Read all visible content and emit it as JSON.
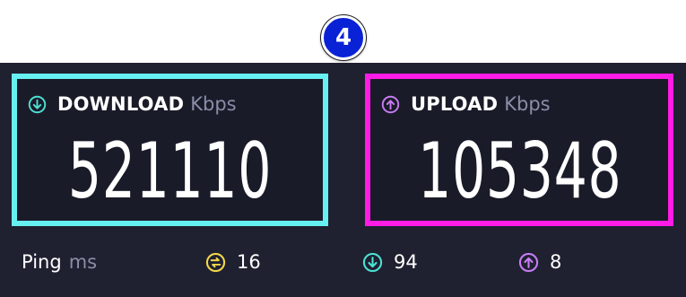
{
  "badge": {
    "number": "4"
  },
  "download": {
    "label": "DOWNLOAD",
    "unit": "Kbps",
    "value": "521110",
    "icon": "arrow-down-circle-icon",
    "border_color": "#66f0f2",
    "icon_color": "#4ce0d2"
  },
  "upload": {
    "label": "UPLOAD",
    "unit": "Kbps",
    "value": "105348",
    "icon": "arrow-up-circle-icon",
    "border_color": "#ff1ce6",
    "icon_color": "#c77cf2"
  },
  "footer": {
    "ping_label": "Ping",
    "ping_unit": "ms",
    "ping_value": "16",
    "ping_icon_color": "#f2d64a",
    "download_value": "94",
    "upload_value": "8"
  }
}
